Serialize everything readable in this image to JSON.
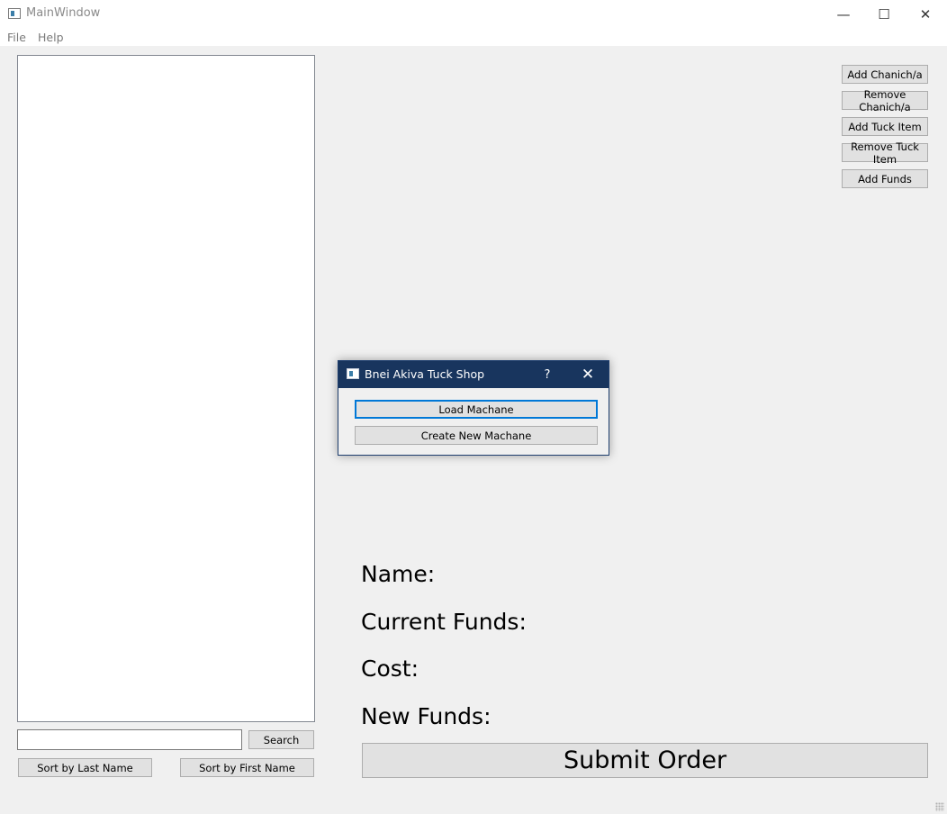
{
  "window": {
    "title": "MainWindow",
    "controls": {
      "minimize": "—",
      "maximize": "☐",
      "close": "✕"
    }
  },
  "menubar": {
    "items": [
      "File",
      "Help"
    ]
  },
  "search": {
    "value": "",
    "button_label": "Search"
  },
  "sort": {
    "last_name_label": "Sort by Last Name",
    "first_name_label": "Sort by First Name"
  },
  "actions": [
    "Add Chanich/a",
    "Remove Chanich/a",
    "Add Tuck Item",
    "Remove Tuck Item",
    "Add Funds"
  ],
  "info": {
    "name_label": "Name:",
    "current_funds_label": "Current Funds:",
    "cost_label": "Cost:",
    "new_funds_label": "New Funds:"
  },
  "submit_label": "Submit Order",
  "dialog": {
    "title": "Bnei Akiva Tuck Shop",
    "help": "?",
    "close": "✕",
    "load_label": "Load Machane",
    "create_label": "Create New Machane"
  },
  "colors": {
    "dialog_titlebar": "#18355e",
    "focus_border": "#0078d7",
    "button_bg": "#e1e1e1",
    "window_bg": "#f0f0f0"
  },
  "icons": [
    "app-icon",
    "minimize-icon",
    "maximize-icon",
    "close-icon",
    "help-icon",
    "resize-grip-icon"
  ]
}
